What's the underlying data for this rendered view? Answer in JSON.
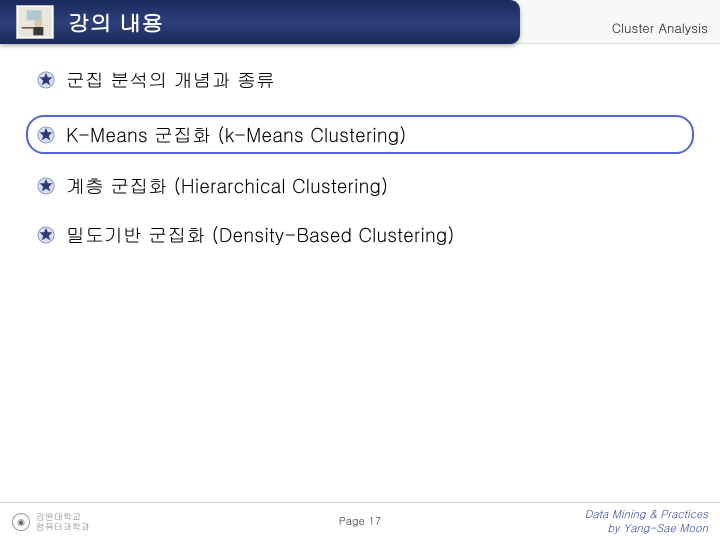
{
  "header": {
    "title": "강의 내용",
    "subtitle": "Cluster Analysis"
  },
  "bullets": {
    "item0": "군집 분석의 개념과 종류",
    "item1": "K-Means 군집화 (k-Means Clustering)",
    "item2": "계층 군집화 (Hierarchical Clustering)",
    "item3": "밀도기반 군집화 (Density-Based Clustering)"
  },
  "footer": {
    "univ_line1": "강원대학교",
    "univ_line2": "컴퓨터과학과",
    "page": "Page 17",
    "credits_line1": "Data Mining & Practices",
    "credits_line2": "by Yang-Sae Moon"
  }
}
